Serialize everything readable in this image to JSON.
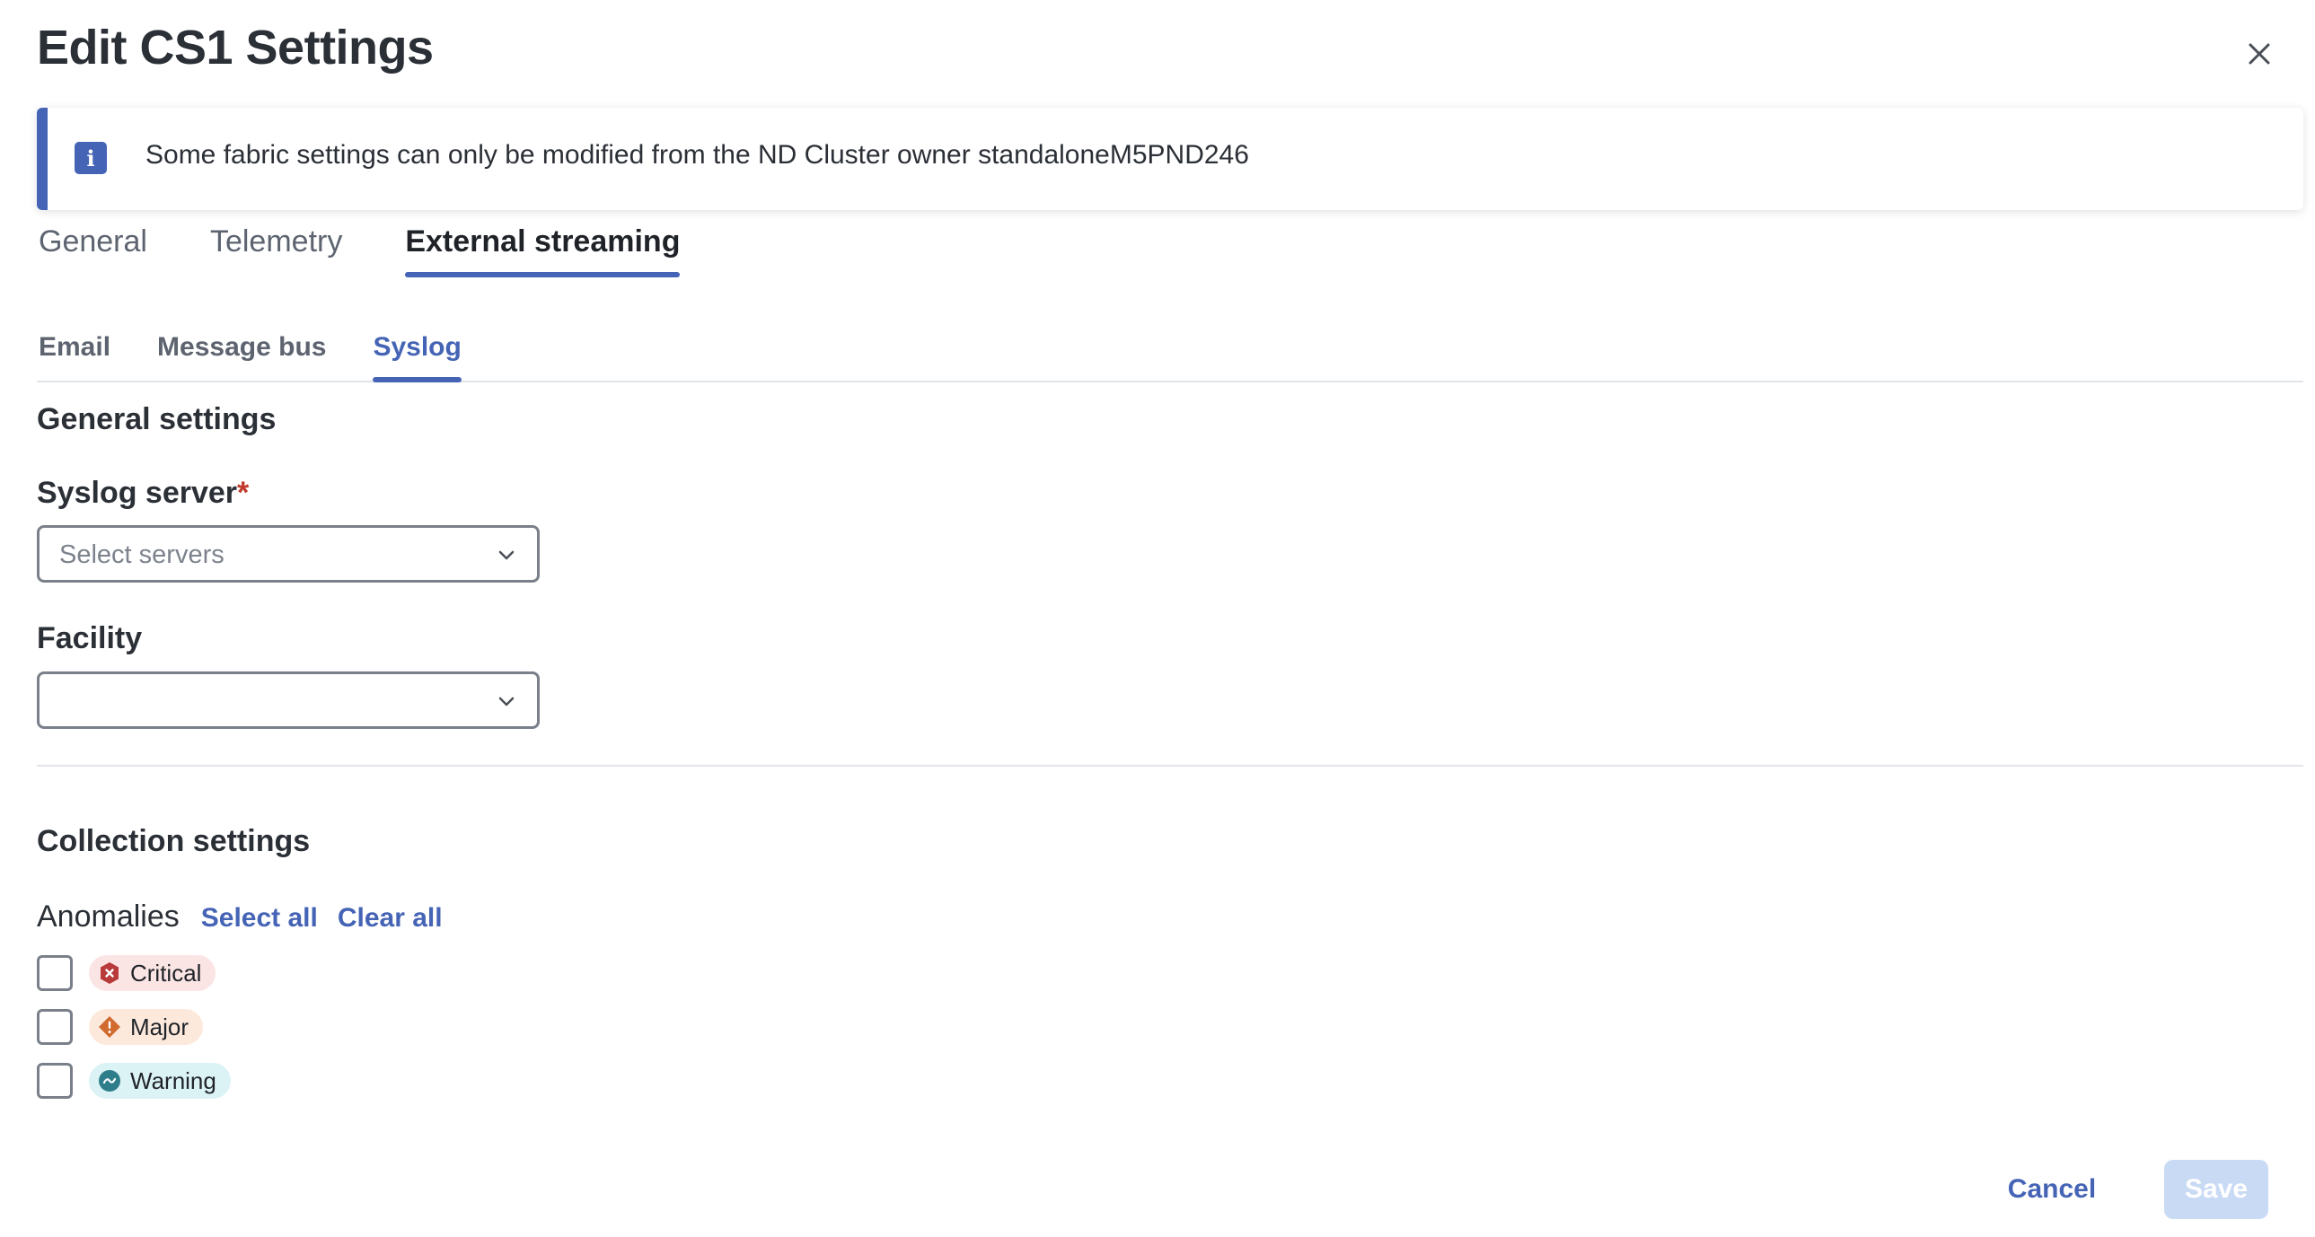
{
  "dialog": {
    "title": "Edit CS1 Settings"
  },
  "banner": {
    "text": "Some fabric settings can only be modified from the ND Cluster owner standaloneM5PND246"
  },
  "main_tabs": [
    {
      "label": "General"
    },
    {
      "label": "Telemetry"
    },
    {
      "label": "External streaming"
    }
  ],
  "main_tab_active": "External streaming",
  "sub_tabs": [
    {
      "label": "Email"
    },
    {
      "label": "Message bus"
    },
    {
      "label": "Syslog"
    }
  ],
  "sub_tab_active": "Syslog",
  "general_settings": {
    "heading": "General settings",
    "syslog_server": {
      "label": "Syslog server",
      "required_marker": "*",
      "placeholder": "Select servers",
      "value": ""
    },
    "facility": {
      "label": "Facility",
      "value": ""
    }
  },
  "collection_settings": {
    "heading": "Collection settings",
    "anomalies_label": "Anomalies",
    "select_all": "Select all",
    "clear_all": "Clear all",
    "items": [
      {
        "label": "Critical",
        "checked": false,
        "icon": "critical-icon",
        "color": "#b83a3a"
      },
      {
        "label": "Major",
        "checked": false,
        "icon": "major-icon",
        "color": "#d06a2e"
      },
      {
        "label": "Warning",
        "checked": false,
        "icon": "warning-icon",
        "color": "#2e7d8a"
      }
    ]
  },
  "footer": {
    "cancel_label": "Cancel",
    "save_label": "Save",
    "save_enabled": false
  },
  "colors": {
    "accent": "#4564b5",
    "save_disabled_bg": "#c9daf5",
    "required": "#c0392b"
  }
}
